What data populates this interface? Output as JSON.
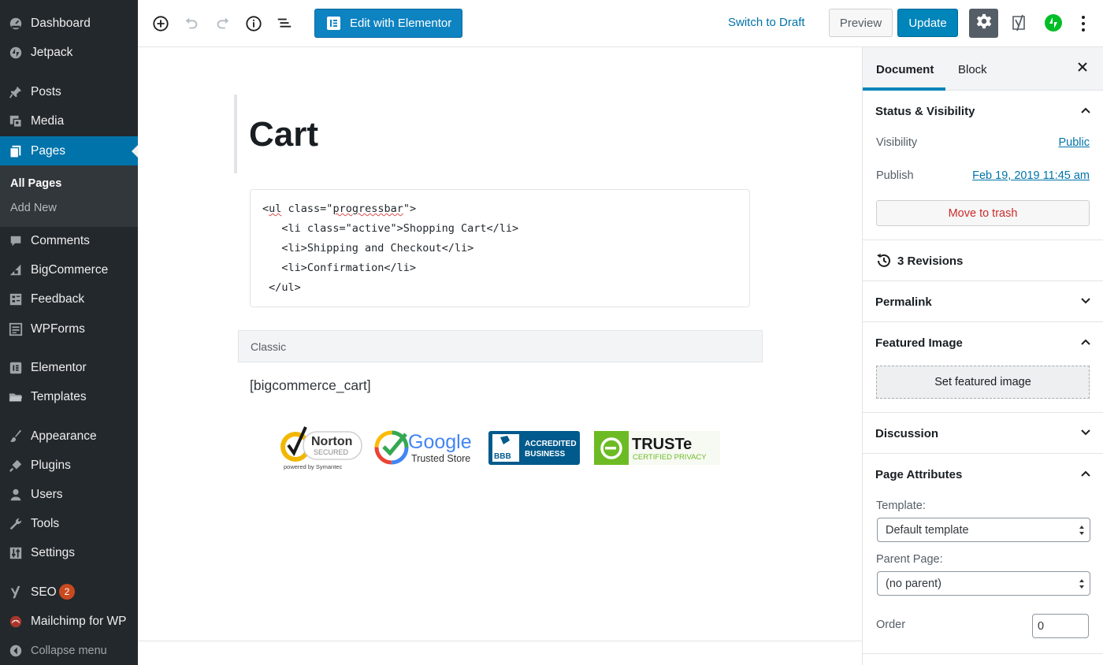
{
  "sidebar": {
    "items": [
      {
        "label": "Dashboard",
        "icon": "dashboard-icon"
      },
      {
        "label": "Jetpack",
        "icon": "jetpack-icon"
      },
      {
        "label": "Posts",
        "icon": "pin-icon"
      },
      {
        "label": "Media",
        "icon": "media-icon"
      },
      {
        "label": "Pages",
        "icon": "pages-icon"
      },
      {
        "label": "Comments",
        "icon": "comment-icon"
      },
      {
        "label": "BigCommerce",
        "icon": "bigcommerce-icon"
      },
      {
        "label": "Feedback",
        "icon": "feedback-icon"
      },
      {
        "label": "WPForms",
        "icon": "wpforms-icon"
      },
      {
        "label": "Elementor",
        "icon": "elementor-icon"
      },
      {
        "label": "Templates",
        "icon": "folder-icon"
      },
      {
        "label": "Appearance",
        "icon": "brush-icon"
      },
      {
        "label": "Plugins",
        "icon": "plug-icon"
      },
      {
        "label": "Users",
        "icon": "user-icon"
      },
      {
        "label": "Tools",
        "icon": "wrench-icon"
      },
      {
        "label": "Settings",
        "icon": "sliders-icon"
      },
      {
        "label": "SEO",
        "icon": "yoast-icon",
        "badge": "2"
      },
      {
        "label": "Mailchimp for WP",
        "icon": "mailchimp-icon"
      }
    ],
    "submenu": [
      "All Pages",
      "Add New"
    ],
    "collapse_label": "Collapse menu"
  },
  "toolbar": {
    "elementor_label": "Edit with Elementor",
    "switch_draft_label": "Switch to Draft",
    "preview_label": "Preview",
    "update_label": "Update"
  },
  "editor": {
    "title": "Cart",
    "code_lines": [
      {
        "pre": "<",
        "squig1": "ul",
        "mid": " class=\"",
        "squig2": "progressbar",
        "post": "\">"
      },
      "   <li class=\"active\">Shopping Cart</li>",
      "   <li>Shipping and Checkout</li>",
      "   <li>Confirmation</li>",
      " </ul>"
    ],
    "classic_label": "Classic",
    "shortcode": "[bigcommerce_cart]",
    "badges": {
      "norton": {
        "name": "Norton",
        "sub": "SECURED",
        "powered": "powered by Symantec"
      },
      "google": {
        "name": "Google",
        "sub": "Trusted Store"
      },
      "bbb": {
        "line1": "ACCREDITED",
        "line2": "BUSINESS",
        "mark": "BBB"
      },
      "truste": {
        "name": "TRUSTe",
        "sub": "CERTIFIED PRIVACY"
      }
    }
  },
  "panel": {
    "tabs": {
      "document": "Document",
      "block": "Block"
    },
    "status": {
      "title": "Status & Visibility",
      "visibility_label": "Visibility",
      "visibility_value": "Public",
      "publish_label": "Publish",
      "publish_value": "Feb 19, 2019 11:45 am",
      "trash_label": "Move to trash"
    },
    "revisions_label": "3 Revisions",
    "permalink_title": "Permalink",
    "featured": {
      "title": "Featured Image",
      "button": "Set featured image"
    },
    "discussion_title": "Discussion",
    "attributes": {
      "title": "Page Attributes",
      "template_label": "Template:",
      "template_value": "Default template",
      "parent_label": "Parent Page:",
      "parent_value": "(no parent)",
      "order_label": "Order",
      "order_value": "0"
    }
  },
  "colors": {
    "accent": "#0085ba",
    "sidebar_bg": "#23282d",
    "active_menu": "#0073aa"
  }
}
